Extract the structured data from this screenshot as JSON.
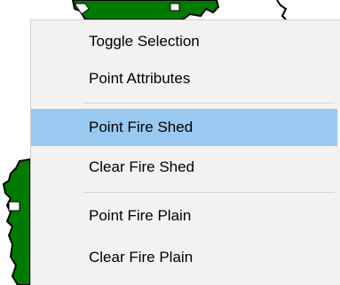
{
  "menu": {
    "items": [
      {
        "label": "Toggle Selection",
        "highlighted": false
      },
      {
        "label": "Point Attributes",
        "highlighted": false
      },
      {
        "label": "Point Fire Shed",
        "highlighted": true
      },
      {
        "label": "Clear Fire Shed",
        "highlighted": false
      },
      {
        "label": "Point Fire Plain",
        "highlighted": false
      },
      {
        "label": "Clear Fire Plain",
        "highlighted": false
      }
    ],
    "highlight_color": "#99c9f0",
    "background_color": "#f2f2f2"
  },
  "map": {
    "region_fill_color": "#007a00"
  }
}
